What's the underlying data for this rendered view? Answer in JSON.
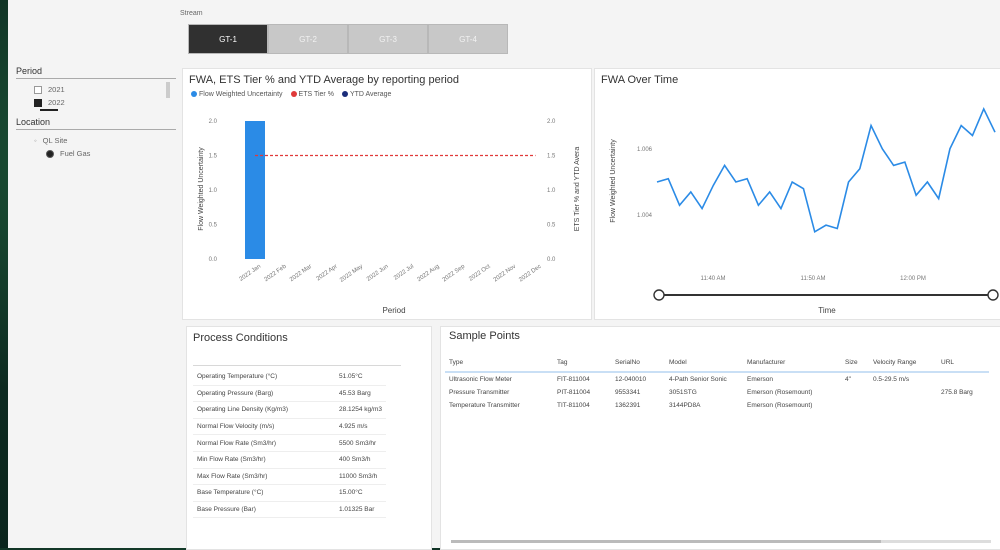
{
  "stream": {
    "label": "Stream",
    "tabs": [
      {
        "label": "GT-1",
        "active": true
      },
      {
        "label": "GT-2",
        "active": false
      },
      {
        "label": "GT-3",
        "active": false
      },
      {
        "label": "GT-4",
        "active": false
      }
    ]
  },
  "filters": {
    "period_label": "Period",
    "period_items": [
      {
        "label": "2021",
        "checked": false
      },
      {
        "label": "2022",
        "checked": true
      }
    ],
    "location_label": "Location",
    "location_items": [
      {
        "label": "QL Site",
        "selected": false
      },
      {
        "label": "Fuel Gas",
        "selected": true
      }
    ]
  },
  "fwa_panel": {
    "title": "FWA, ETS Tier % and YTD Average by reporting period",
    "legend": [
      {
        "label": "Flow Weighted Uncertainty",
        "color": "#2b8be6"
      },
      {
        "label": "ETS Tier %",
        "color": "#e03a3a"
      },
      {
        "label": "YTD Average",
        "color": "#1b2d7a"
      }
    ]
  },
  "chart_data": [
    {
      "type": "bar",
      "title": "FWA, ETS Tier % and YTD Average by reporting period",
      "xlabel": "Period",
      "ylabel": "Flow Weighted Uncertainty",
      "y2label": "ETS Tier % and YTD Avera",
      "categories": [
        "2022 Jan",
        "2022 Feb",
        "2022 Mar",
        "2022 Apr",
        "2022 May",
        "2022 Jun",
        "2022 Jul",
        "2022 Aug",
        "2022 Sep",
        "2022 Oct",
        "2022 Nov",
        "2022 Dec"
      ],
      "series": [
        {
          "name": "Flow Weighted Uncertainty",
          "values": [
            2.0,
            0,
            0,
            0,
            0,
            0,
            0,
            0,
            0,
            0,
            0,
            0
          ]
        },
        {
          "name": "ETS Tier %",
          "values": [
            1.5,
            1.5,
            1.5,
            1.5,
            1.5,
            1.5,
            1.5,
            1.5,
            1.5,
            1.5,
            1.5,
            1.5
          ]
        }
      ],
      "yticks": [
        "0.0",
        "0.5",
        "1.0",
        "1.5",
        "2.0"
      ],
      "y2ticks": [
        "0.0",
        "0.5",
        "1.0",
        "1.5",
        "2.0"
      ],
      "ylim": [
        0,
        2.0
      ]
    },
    {
      "type": "line",
      "title": "FWA Over Time",
      "xlabel": "Time",
      "ylabel": "Flow Weighted Uncertainty",
      "x_ticks": [
        "11:40 AM",
        "11:50 AM",
        "12:00 PM"
      ],
      "y_ticks": [
        "1.004",
        "1.006"
      ],
      "ylim": [
        1.0025,
        1.0075
      ],
      "values": [
        1.005,
        1.0051,
        1.0043,
        1.0047,
        1.0042,
        1.0049,
        1.0055,
        1.005,
        1.0051,
        1.0043,
        1.0047,
        1.0042,
        1.005,
        1.0048,
        1.0035,
        1.0037,
        1.0036,
        1.005,
        1.0054,
        1.0067,
        1.006,
        1.0055,
        1.0056,
        1.0046,
        1.005,
        1.0045,
        1.006,
        1.0067,
        1.0064,
        1.0072,
        1.0065
      ]
    }
  ],
  "fwa_time_panel": {
    "title": "FWA Over Time"
  },
  "process_conditions": {
    "title": "Process Conditions",
    "rows": [
      {
        "label": "Operating Temperature (°C)",
        "value": "51.05°C"
      },
      {
        "label": "Operating Pressure (Barg)",
        "value": "45.53 Barg"
      },
      {
        "label": "Operating Line Density (Kg/m3)",
        "value": "28.1254 kg/m3"
      },
      {
        "label": "Normal Flow Velocity (m/s)",
        "value": "4.925 m/s"
      },
      {
        "label": "Normal Flow Rate (Sm3/hr)",
        "value": "5500 Sm3/hr"
      },
      {
        "label": "Min Flow Rate (Sm3/hr)",
        "value": "400 Sm3/h"
      },
      {
        "label": "Max Flow Rate (Sm3/hr)",
        "value": "11000 Sm3/h"
      },
      {
        "label": "Base Temperature (°C)",
        "value": "15.00°C"
      },
      {
        "label": "Base Pressure (Bar)",
        "value": "1.01325 Bar"
      }
    ]
  },
  "sample_points": {
    "title": "Sample Points",
    "columns": [
      "Type",
      "Tag",
      "SerialNo",
      "Model",
      "Manufacturer",
      "Size",
      "Velocity Range",
      "URL"
    ],
    "rows": [
      [
        "Ultrasonic Flow Meter",
        "FIT-811004",
        "12-040010",
        "4-Path Senior Sonic",
        "Emerson",
        "4\"",
        "0.5-29.5 m/s",
        ""
      ],
      [
        "Pressure Transmitter",
        "PIT-811004",
        "9553341",
        "3051STG",
        "Emerson (Rosemount)",
        "",
        "",
        "275.8 Barg"
      ],
      [
        "Temperature Transmitter",
        "TIT-811004",
        "1362391",
        "3144PD8A",
        "Emerson (Rosemount)",
        "",
        "",
        ""
      ]
    ]
  }
}
